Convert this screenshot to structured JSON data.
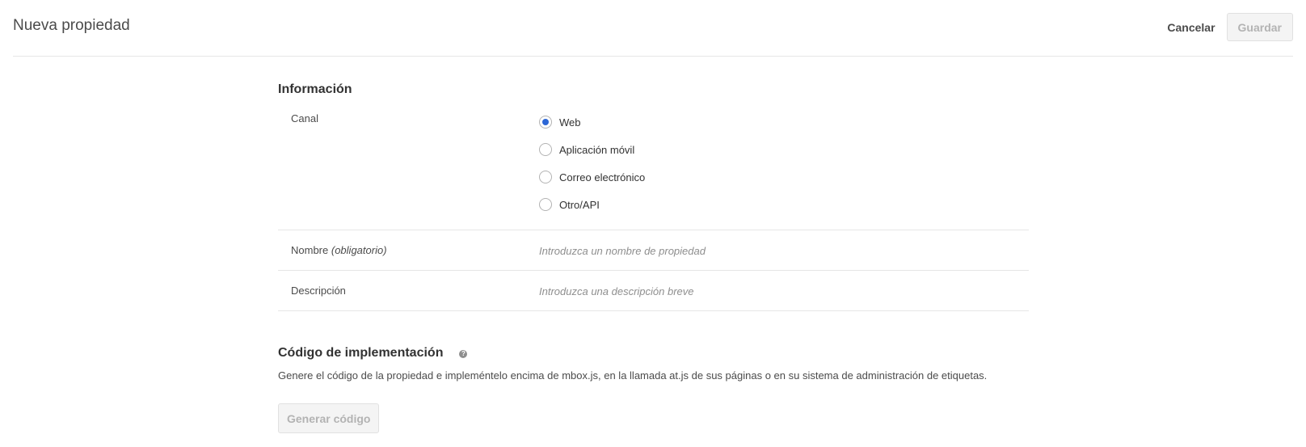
{
  "header": {
    "title": "Nueva propiedad",
    "cancel_label": "Cancelar",
    "save_label": "Guardar"
  },
  "info_section": {
    "heading": "Información",
    "channel": {
      "label": "Canal",
      "options": [
        {
          "label": "Web",
          "selected": true
        },
        {
          "label": "Aplicación móvil",
          "selected": false
        },
        {
          "label": "Correo electrónico",
          "selected": false
        },
        {
          "label": "Otro/API",
          "selected": false
        }
      ]
    },
    "name": {
      "label": "Nombre",
      "label_suffix": "(obligatorio)",
      "value": "",
      "placeholder": "Introduzca un nombre de propiedad"
    },
    "description": {
      "label": "Descripción",
      "value": "",
      "placeholder": "Introduzca una descripción breve"
    }
  },
  "implementation": {
    "heading": "Código de implementación",
    "help_icon": "question-mark-icon",
    "description": "Genere el código de la propiedad e impleméntelo encima de mbox.js, en la llamada at.js de sus páginas o en su sistema de administración de etiquetas.",
    "generate_label": "Generar código"
  },
  "colors": {
    "accent": "#2d67d6",
    "disabled_text": "#b3b3b3",
    "disabled_bg": "#f4f4f4",
    "divider": "#e6e6e6"
  }
}
